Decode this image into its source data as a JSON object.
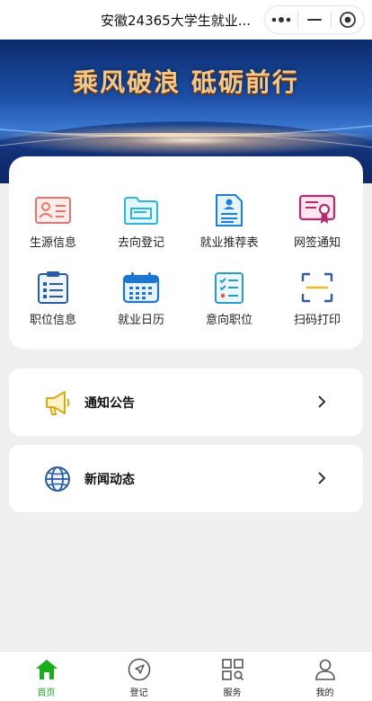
{
  "header": {
    "title": "安徽24365大学生就业..."
  },
  "banner": {
    "slogan": "乘风破浪 砥砺前行"
  },
  "grid": [
    {
      "label": "生源信息",
      "icon": "id-card-icon"
    },
    {
      "label": "去向登记",
      "icon": "folder-icon"
    },
    {
      "label": "就业推荐表",
      "icon": "document-person-icon"
    },
    {
      "label": "网签通知",
      "icon": "certificate-icon"
    },
    {
      "label": "职位信息",
      "icon": "clipboard-list-icon"
    },
    {
      "label": "就业日历",
      "icon": "calendar-icon"
    },
    {
      "label": "意向职位",
      "icon": "checklist-icon"
    },
    {
      "label": "扫码打印",
      "icon": "scan-icon"
    }
  ],
  "list": [
    {
      "label": "通知公告",
      "icon": "megaphone-icon"
    },
    {
      "label": "新闻动态",
      "icon": "globe-icon"
    }
  ],
  "tabs": [
    {
      "label": "首页",
      "icon": "home-icon",
      "active": true
    },
    {
      "label": "登记",
      "icon": "send-icon",
      "active": false
    },
    {
      "label": "服务",
      "icon": "grid-search-icon",
      "active": false
    },
    {
      "label": "我的",
      "icon": "user-icon",
      "active": false
    }
  ],
  "colors": {
    "active_tab": "#1aad19",
    "banner_text": "#f3c98a"
  }
}
